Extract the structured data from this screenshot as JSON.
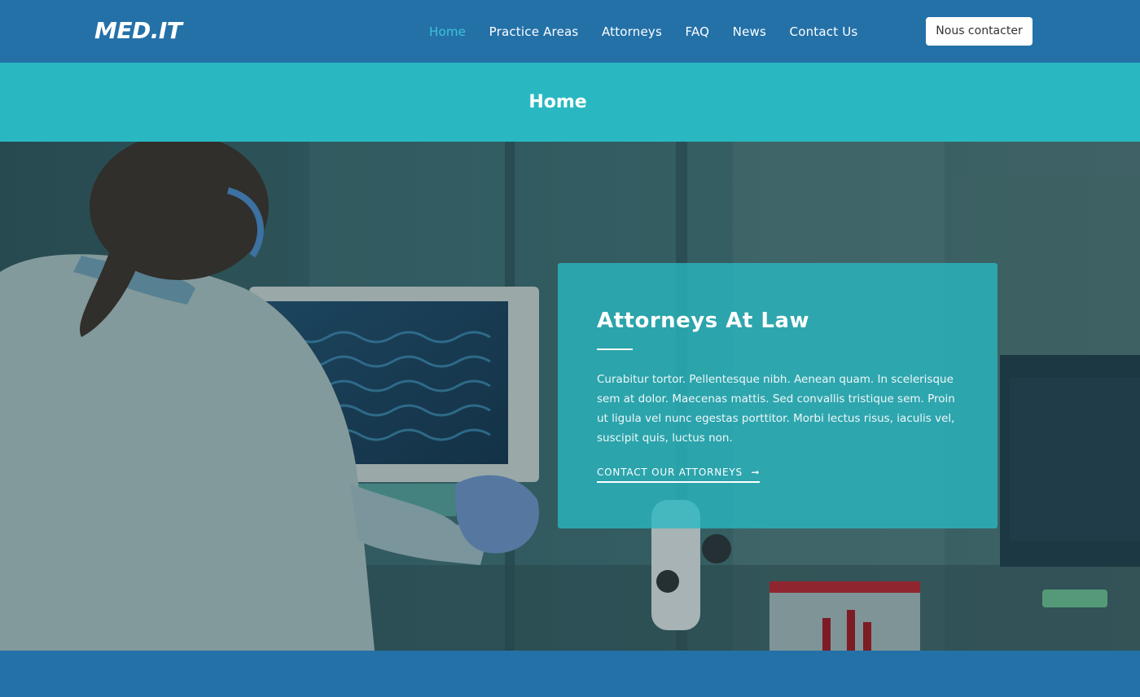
{
  "header": {
    "logo": "MED.IT",
    "nav": [
      "Home",
      "Practice Areas",
      "Attorneys",
      "FAQ",
      "News",
      "Contact Us"
    ],
    "active_index": 0,
    "cta_label": "Nous contacter"
  },
  "page_title": "Home",
  "hero": {
    "heading": "Attorneys At Law",
    "body": "Curabitur tortor. Pellentesque nibh. Aenean quam. In scelerisque sem at dolor. Maecenas mattis. Sed convallis tristique sem. Proin ut ligula vel nunc egestas porttitor. Morbi lectus risus, iaculis vel, suscipit quis, luctus non.",
    "link_label": "CONTACT OUR ATTORNEYS",
    "link_icon": "arrow-right-icon"
  },
  "colors": {
    "header_bg": "#2471a8",
    "title_bar_bg": "#29b8c1",
    "nav_active": "#3ec3d6",
    "card_bg": "#29b8c1"
  }
}
